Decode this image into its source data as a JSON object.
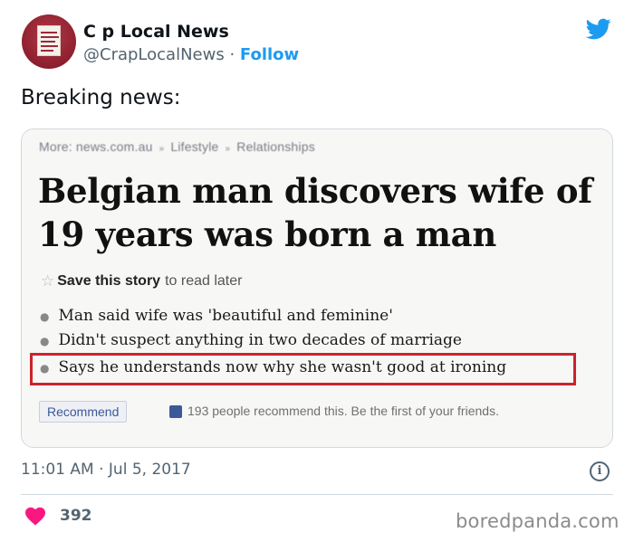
{
  "tweet": {
    "author": {
      "display_name": "C  p Local News",
      "handle": "@CrapLocalNews",
      "follow_label": "Follow"
    },
    "text": "Breaking news:",
    "timestamp": "11:01 AM · Jul 5, 2017",
    "likes": "392",
    "brand_icon": "twitter-bird-icon",
    "brand_color": "#1d9bf0",
    "like_color": "#f91880"
  },
  "article": {
    "breadcrumbs": [
      "More: news.com.au",
      "Lifestyle",
      "Relationships"
    ],
    "headline": "Belgian man discovers wife of 19 years was born a man",
    "save_bold": "Save this story",
    "save_rest": "to read later",
    "bullets": [
      "Man said wife was 'beautiful and feminine'",
      "Didn't suspect anything in two decades of marriage",
      "Says he understands now why she wasn't good at ironing"
    ],
    "highlight_color": "#c9242c",
    "recommend_label": "Recommend",
    "recommend_text": "193 people recommend this. Be the first of your friends."
  },
  "watermark": "boredpanda.com"
}
